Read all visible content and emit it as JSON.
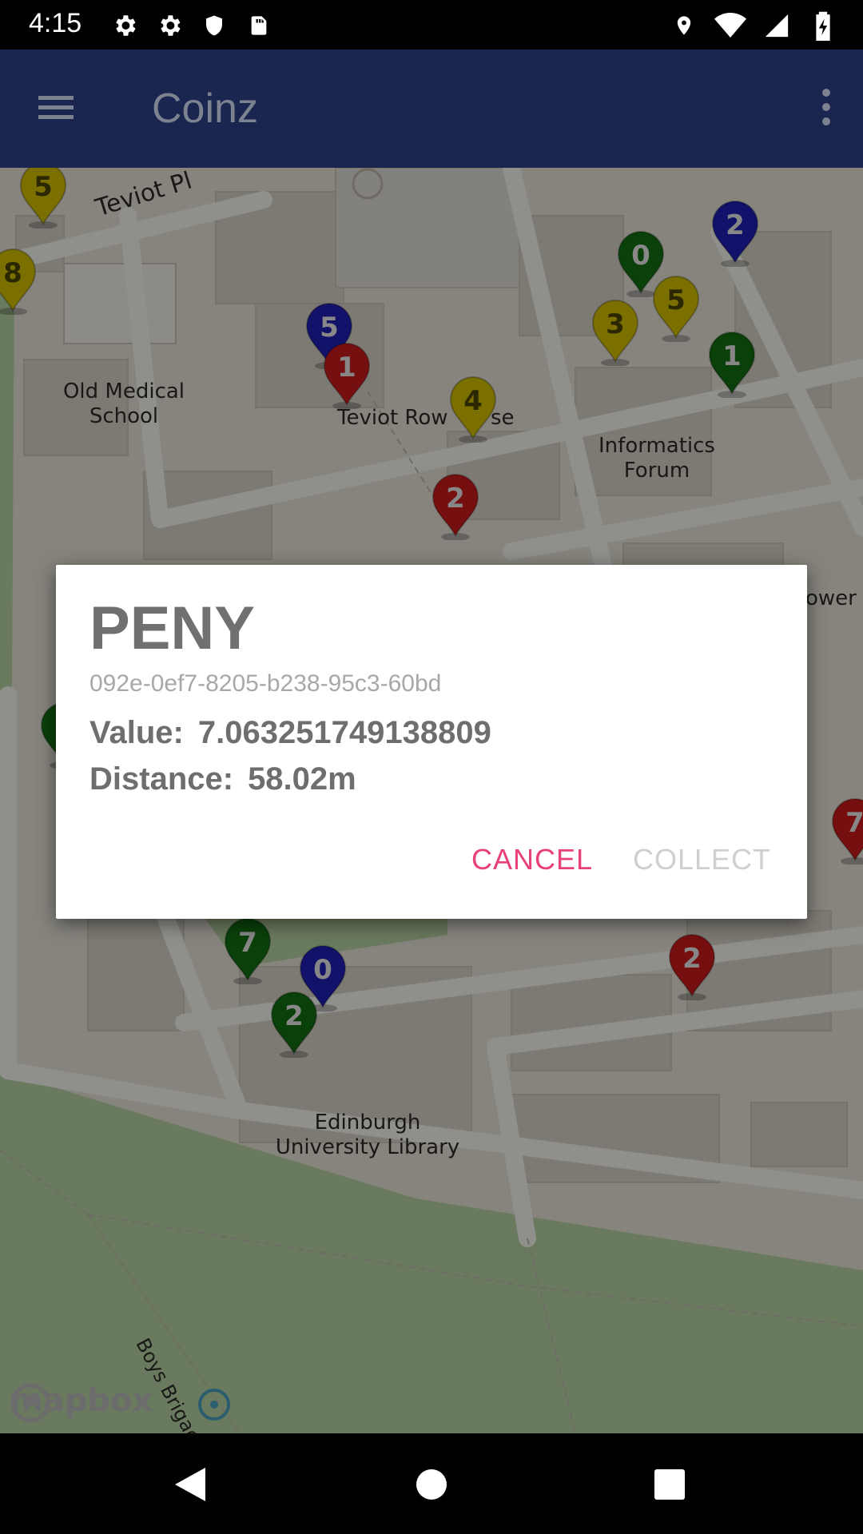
{
  "status_bar": {
    "time": "4:15",
    "left_icons": [
      "gear-icon",
      "gear-icon",
      "shield-icon",
      "sd-card-icon"
    ],
    "right_icons": [
      "location-icon",
      "wifi-icon",
      "signal-icon",
      "battery-charging-icon"
    ]
  },
  "app_bar": {
    "title": "Coinz",
    "color": "#1a2550"
  },
  "map": {
    "labels": {
      "teviot_pl": "Teviot Pl",
      "old_medical_1": "Old Medical",
      "old_medical_2": "School",
      "teviot_row": "Teviot Row",
      "teviot_row_tail": "se",
      "informatics_1": "Informatics",
      "informatics_2": "Forum",
      "tower_fragment": "ower",
      "library_1": "Edinburgh",
      "library_2": "University Library",
      "boys_brigade": "Boys Brigade"
    },
    "attribution": "mapbox",
    "markers": [
      {
        "label": "5",
        "color": "#d4c000"
      },
      {
        "label": "8",
        "color": "#d4c000"
      },
      {
        "label": "5",
        "color": "#1f1fb8"
      },
      {
        "label": "1",
        "color": "#cc1a1a"
      },
      {
        "label": "4",
        "color": "#d4c000"
      },
      {
        "label": "2",
        "color": "#cc1a1a"
      },
      {
        "label": "2",
        "color": "#1f1fb8"
      },
      {
        "label": "0",
        "color": "#127012"
      },
      {
        "label": "5",
        "color": "#d4c000"
      },
      {
        "label": "3",
        "color": "#d4c000"
      },
      {
        "label": "1",
        "color": "#127012"
      },
      {
        "label": "7",
        "color": "#127012"
      },
      {
        "label": "0",
        "color": "#1f1fb8"
      },
      {
        "label": "2",
        "color": "#127012"
      },
      {
        "label": "2",
        "color": "#cc1a1a"
      },
      {
        "label": "7",
        "color": "#cc1a1a"
      },
      {
        "label": "",
        "color": "#127012"
      }
    ]
  },
  "dialog": {
    "title": "PENY",
    "coin_id": "092e-0ef7-8205-b238-95c3-60bd",
    "value_label": "Value:",
    "value": "7.063251749138809",
    "distance_label": "Distance:",
    "distance": "58.02m",
    "cancel_label": "CANCEL",
    "collect_label": "COLLECT",
    "accent_color": "#e8407a"
  }
}
